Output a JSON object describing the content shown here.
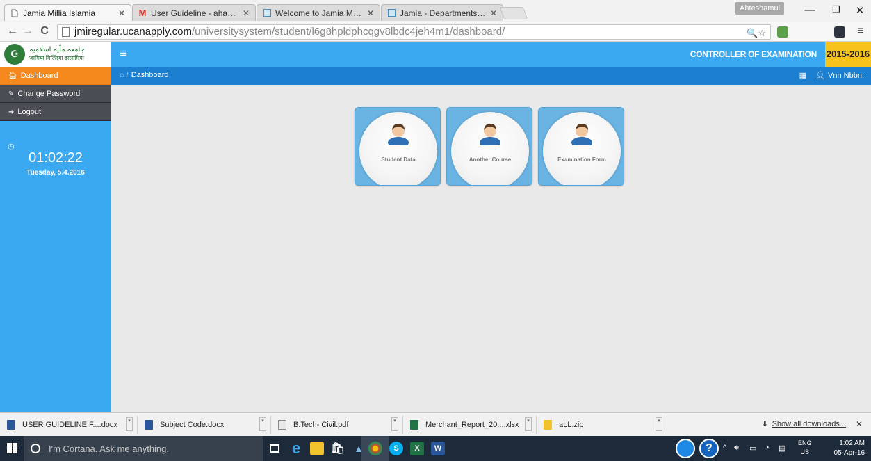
{
  "browser": {
    "tabs": [
      {
        "title": "Jamia Millia Islamia",
        "icon": "page-icon",
        "active": true
      },
      {
        "title": "User Guideline - ahaque",
        "icon": "gmail-icon",
        "active": false
      },
      {
        "title": "Welcome to Jamia Millia I",
        "icon": "site-icon",
        "active": false
      },
      {
        "title": "Jamia - Departments - Off",
        "icon": "site-icon",
        "active": false
      }
    ],
    "profile_name": "Ahteshamul",
    "url_host": "jmiregular.ucanapply.com",
    "url_path": "/universitysystem/student/l6g8hpldphcqgv8lbdc4jeh4m1/dashboard/"
  },
  "header": {
    "logo_text_urdu": "جامعہ ملّیہ اسلامیہ",
    "logo_text_hindi": "जामिया मिल्लिया इस्लामिया",
    "controller_label": "CONTROLLER OF EXAMINATION",
    "session": "2015-2016"
  },
  "breadcrumb": {
    "page": "Dashboard",
    "user": "Vnn Nbbn!"
  },
  "sidebar": {
    "items": [
      {
        "label": "Dashboard",
        "icon": "home-icon",
        "active": true
      },
      {
        "label": "Change Password",
        "icon": "edit-icon",
        "active": false
      },
      {
        "label": "Logout",
        "icon": "logout-icon",
        "active": false
      }
    ],
    "clock_time": "01:02:22",
    "clock_date": "Tuesday, 5.4.2016"
  },
  "cards": [
    {
      "label": "Student Data",
      "icon": "user-avatar-icon"
    },
    {
      "label": "Another Course",
      "icon": "user-avatar-icon"
    },
    {
      "label": "Examination Form",
      "icon": "user-avatar-icon"
    }
  ],
  "downloads": {
    "items": [
      {
        "name": "USER GUIDELINE F....docx",
        "type": "word"
      },
      {
        "name": "Subject Code.docx",
        "type": "word"
      },
      {
        "name": "B.Tech- Civil.pdf",
        "type": "pdf"
      },
      {
        "name": "Merchant_Report_20....xlsx",
        "type": "excel"
      },
      {
        "name": "aLL.zip",
        "type": "zip"
      }
    ],
    "show_all": "Show all downloads..."
  },
  "taskbar": {
    "search_placeholder": "I'm Cortana. Ask me anything.",
    "lang_1": "ENG",
    "lang_2": "US",
    "time": "1:02 AM",
    "date": "05-Apr-16"
  },
  "colors": {
    "header_blue": "#3aa9f2",
    "breadcrumb_blue": "#1c7fd0",
    "active_orange": "#f5891e",
    "year_yellow": "#f7c31b",
    "card_blue": "#6ab4e4"
  }
}
